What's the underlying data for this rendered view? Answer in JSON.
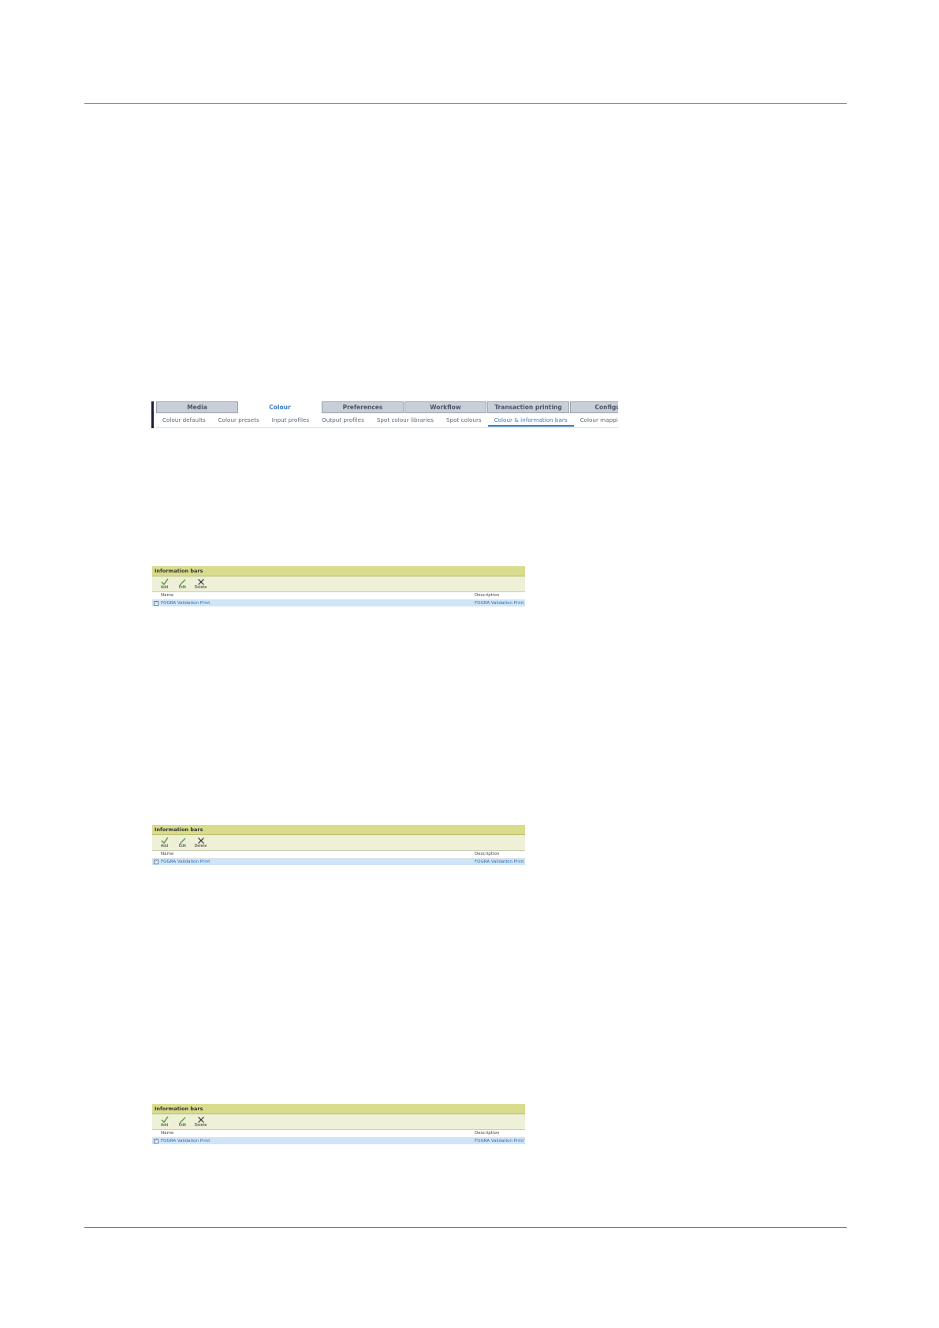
{
  "tabs": {
    "main": [
      "Media",
      "Colour",
      "Preferences",
      "Workflow",
      "Transaction printing",
      "Configure"
    ],
    "active_main": 1,
    "sub": [
      "Colour defaults",
      "Colour presets",
      "Input profiles",
      "Output profiles",
      "Spot colour libraries",
      "Spot colours",
      "Colour & information bars",
      "Colour mappings"
    ],
    "active_sub": 6
  },
  "panels": [
    {
      "title": "Information bars",
      "tools": [
        {
          "label": "Add",
          "icon": "add-check-icon"
        },
        {
          "label": "Edit",
          "icon": "edit-pencil-icon"
        },
        {
          "label": "Delete",
          "icon": "delete-x-icon"
        }
      ],
      "columns": [
        "Name",
        "Description"
      ],
      "rows": [
        {
          "name": "FOGRA Validation Print",
          "description": "FOGRA Validation Print"
        }
      ]
    },
    {
      "title": "Information bars",
      "tools": [
        {
          "label": "Add",
          "icon": "add-check-icon"
        },
        {
          "label": "Edit",
          "icon": "edit-pencil-icon"
        },
        {
          "label": "Delete",
          "icon": "delete-x-icon"
        }
      ],
      "columns": [
        "Name",
        "Description"
      ],
      "rows": [
        {
          "name": "FOGRA Validation Print",
          "description": "FOGRA Validation Print"
        }
      ]
    },
    {
      "title": "Information bars",
      "tools": [
        {
          "label": "Add",
          "icon": "add-check-icon"
        },
        {
          "label": "Edit",
          "icon": "edit-pencil-icon"
        },
        {
          "label": "Delete",
          "icon": "delete-x-icon"
        }
      ],
      "columns": [
        "Name",
        "Description"
      ],
      "rows": [
        {
          "name": "FOGRA Validation Print",
          "description": "FOGRA Validation Print"
        }
      ]
    }
  ],
  "colors": {
    "rule": "#d9534f",
    "panel_title": "#d9dc8c",
    "toolbar": "#eef0d8",
    "selected_row": "#cfe4f7",
    "active_tab_text": "#3b78c2"
  }
}
